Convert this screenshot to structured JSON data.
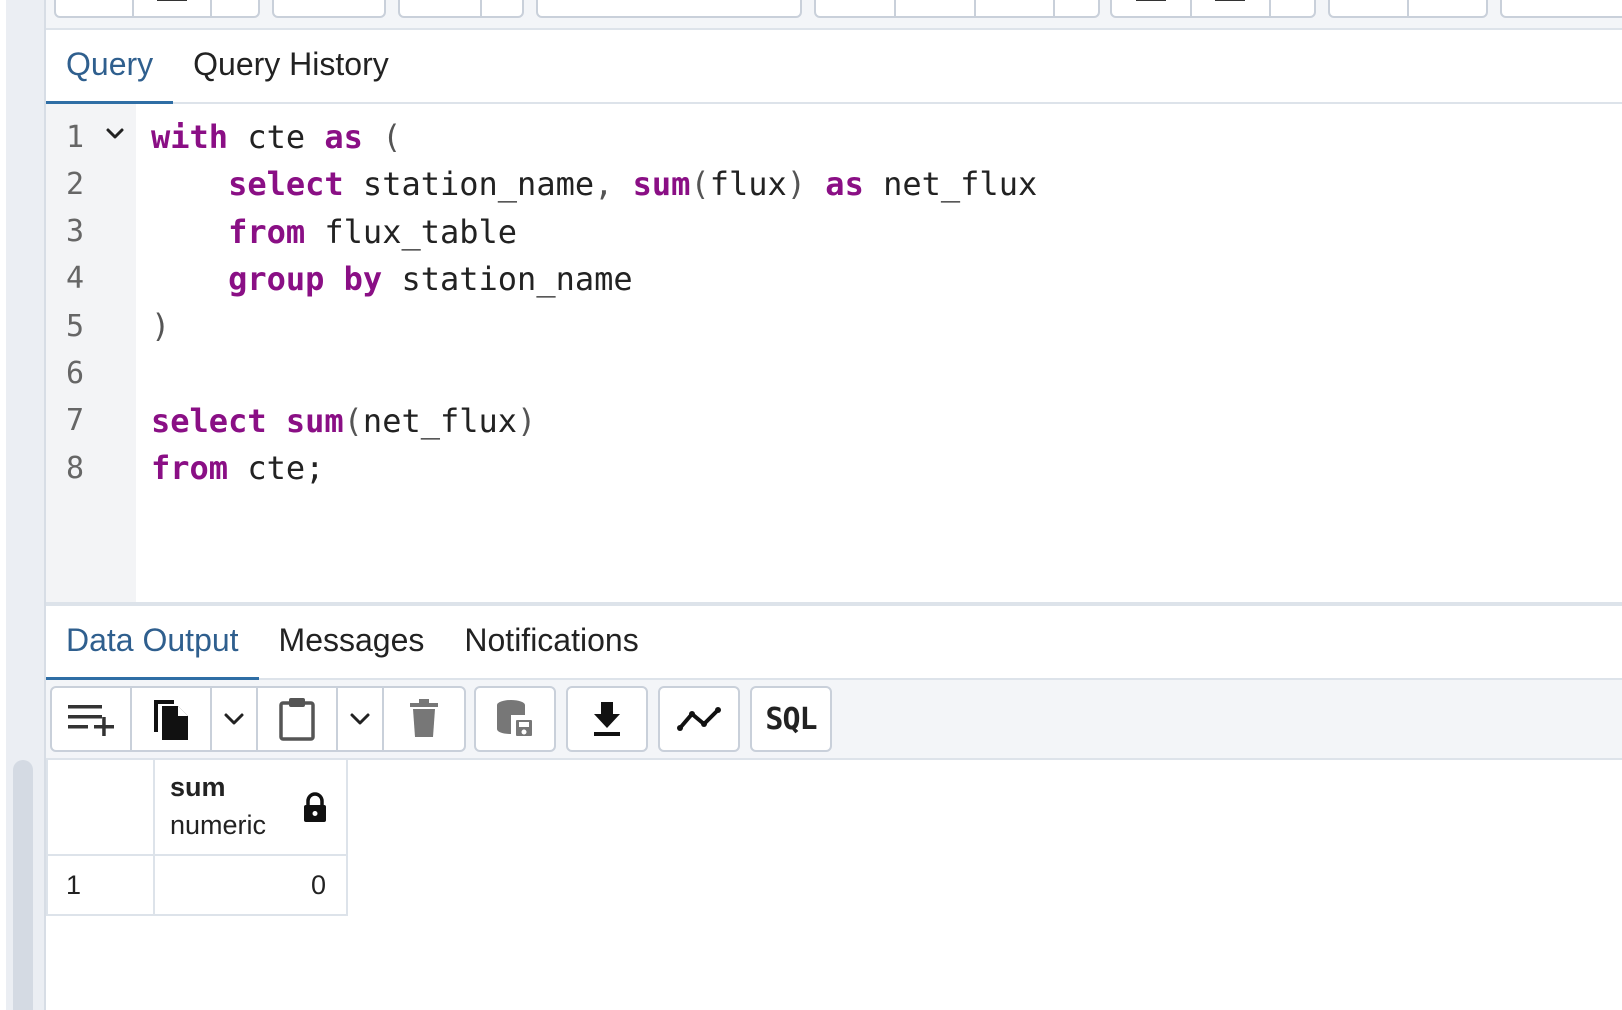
{
  "editor_tabs": [
    {
      "label": "Query",
      "active": true
    },
    {
      "label": "Query History",
      "active": false
    }
  ],
  "editor": {
    "line_numbers": [
      "1",
      "2",
      "3",
      "4",
      "5",
      "6",
      "7",
      "8"
    ],
    "lines": [
      [
        {
          "t": "with",
          "k": "kw"
        },
        {
          "t": " cte "
        },
        {
          "t": "as",
          "k": "kw"
        },
        {
          "t": " (",
          "k": "pn"
        }
      ],
      [
        {
          "t": "    "
        },
        {
          "t": "select",
          "k": "kw"
        },
        {
          "t": " station_name"
        },
        {
          "t": ",",
          "k": "pn"
        },
        {
          "t": " "
        },
        {
          "t": "sum",
          "k": "kw"
        },
        {
          "t": "(",
          "k": "pn"
        },
        {
          "t": "flux"
        },
        {
          "t": ")",
          "k": "pn"
        },
        {
          "t": " "
        },
        {
          "t": "as",
          "k": "kw"
        },
        {
          "t": " net_flux"
        }
      ],
      [
        {
          "t": "    "
        },
        {
          "t": "from",
          "k": "kw"
        },
        {
          "t": " flux_table"
        }
      ],
      [
        {
          "t": "    "
        },
        {
          "t": "group by",
          "k": "kw"
        },
        {
          "t": " station_name"
        }
      ],
      [
        {
          "t": ")",
          "k": "pn"
        }
      ],
      [],
      [
        {
          "t": "select",
          "k": "kw"
        },
        {
          "t": " "
        },
        {
          "t": "sum",
          "k": "kw"
        },
        {
          "t": "(",
          "k": "pn"
        },
        {
          "t": "net_flux"
        },
        {
          "t": ")",
          "k": "pn"
        }
      ],
      [
        {
          "t": "from",
          "k": "kw"
        },
        {
          "t": " cte;"
        }
      ]
    ]
  },
  "result_tabs": [
    {
      "label": "Data Output",
      "active": true
    },
    {
      "label": "Messages",
      "active": false
    },
    {
      "label": "Notifications",
      "active": false
    }
  ],
  "result_toolbar": {
    "sql_label": "SQL",
    "icons": [
      "add-row-icon",
      "copy-icon",
      "chevron-down-icon",
      "paste-icon",
      "chevron-down-icon",
      "delete-icon",
      "save-data-icon",
      "download-icon",
      "graph-visualiser-icon",
      "sql-icon"
    ]
  },
  "grid": {
    "columns": [
      {
        "name": "sum",
        "type": "numeric",
        "readonly_icon": "lock-icon"
      }
    ],
    "rows": [
      {
        "row_number": "1",
        "values": [
          "0"
        ]
      }
    ]
  },
  "colors": {
    "keyword": "#8a0f85",
    "active_tab": "#2f5f8e",
    "tab_indicator": "#2f6ea5"
  }
}
